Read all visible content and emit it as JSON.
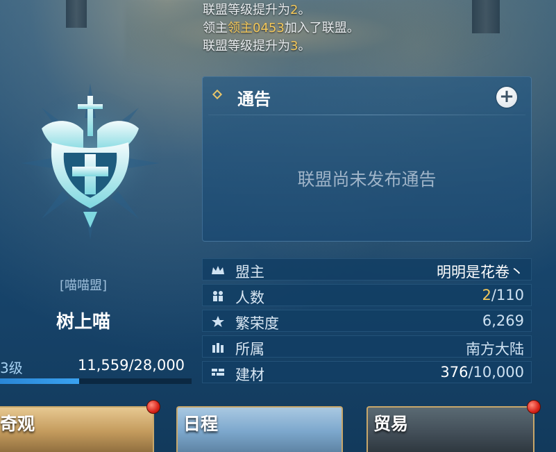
{
  "log": {
    "lines": [
      {
        "pre": "联盟等级提升为",
        "hl": "2",
        "post": "。"
      },
      {
        "pre": "领主",
        "hl": "领主0453",
        "post": "加入了联盟。"
      },
      {
        "pre": "联盟等级提升为",
        "hl": "3",
        "post": "。"
      }
    ]
  },
  "alliance": {
    "tag": "[喵喵盟]",
    "name": "树上喵",
    "level_label": "3级",
    "exp": "11,559/28,000",
    "exp_progress": 0.413
  },
  "notice": {
    "title": "通告",
    "add_icon": "plus-circle-icon",
    "empty_text": "联盟尚未发布通告"
  },
  "info": {
    "leader": {
      "label": "盟主",
      "value": "明明是花卷丶",
      "icon": "crown-icon"
    },
    "members": {
      "label": "人数",
      "current": "2",
      "max": "/110",
      "icon": "people-icon"
    },
    "prosperity": {
      "label": "繁荣度",
      "value": "6,269",
      "icon": "star-icon"
    },
    "region": {
      "label": "所属",
      "value": "南方大陆",
      "icon": "castle-icon"
    },
    "materials": {
      "label": "建材",
      "current": "376",
      "max": "/10,000",
      "icon": "bricks-icon"
    }
  },
  "cards": [
    {
      "title": "奇观",
      "badge": true
    },
    {
      "title": "日程",
      "badge": false
    },
    {
      "title": "贸易",
      "badge": true
    }
  ],
  "colors": {
    "accent_gold": "#f4c85a",
    "panel": "#1c4a72",
    "bar_fill": "#2a86d6"
  }
}
